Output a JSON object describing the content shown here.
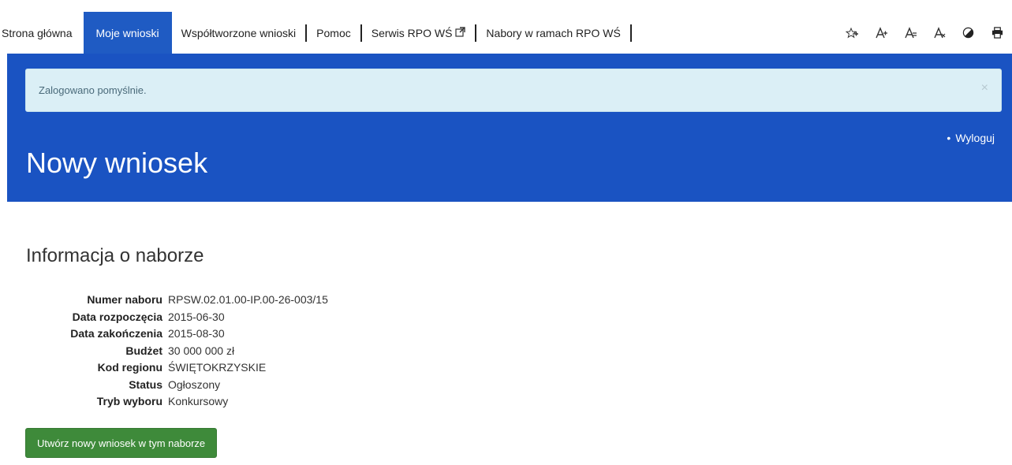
{
  "nav": {
    "items": [
      {
        "label": "Strona główna"
      },
      {
        "label": "Moje wnioski",
        "active": true
      },
      {
        "label": "Współtworzone wnioski"
      },
      {
        "label": "Pomoc"
      },
      {
        "label": "Serwis RPO WŚ",
        "external": true
      },
      {
        "label": "Nabory w ramach RPO WŚ"
      }
    ],
    "tools": [
      {
        "icon": "contrast-star-icon"
      },
      {
        "icon": "font-larger-icon"
      },
      {
        "icon": "font-default-icon"
      },
      {
        "icon": "font-smaller-icon"
      },
      {
        "icon": "high-contrast-icon"
      },
      {
        "icon": "print-icon"
      }
    ],
    "active_color": "#1f5bc3"
  },
  "alert": {
    "message": "Zalogowano pomyślnie.",
    "close_symbol": "×"
  },
  "header": {
    "logout_label": "Wyloguj",
    "title": "Nowy wniosek",
    "band_color": "#1a53c2"
  },
  "main": {
    "section_title": "Informacja o naborze",
    "info": [
      {
        "label": "Numer naboru",
        "value": "RPSW.02.01.00-IP.00-26-003/15"
      },
      {
        "label": "Data rozpoczęcia",
        "value": "2015-06-30"
      },
      {
        "label": "Data zakończenia",
        "value": "2015-08-30"
      },
      {
        "label": "Budżet",
        "value": "30 000 000 zł"
      },
      {
        "label": "Kod regionu",
        "value": "ŚWIĘTOKRZYSKIE"
      },
      {
        "label": "Status",
        "value": "Ogłoszony"
      },
      {
        "label": "Tryb wyboru",
        "value": "Konkursowy"
      }
    ],
    "create_button_label": "Utwórz nowy wniosek w tym naborze",
    "button_color": "#3e8a3a"
  }
}
